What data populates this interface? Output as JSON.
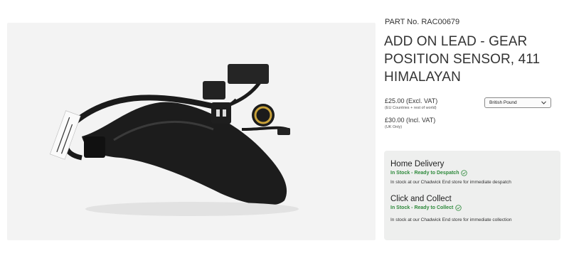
{
  "product": {
    "part_no": "PART No. RAC00679",
    "title": "ADD ON LEAD - GEAR POSITION SENSOR, 411 HIMALAYAN"
  },
  "pricing": {
    "excl": "£25.00 (Excl. VAT)",
    "excl_note": "(EU Countries + rest of world)",
    "incl": "£30.00 (Incl. VAT)",
    "incl_note": "(UK Only)",
    "currency": "British Pound"
  },
  "availability": {
    "home_delivery": {
      "title": "Home Delivery",
      "status": "In Stock - Ready to Despatch",
      "detail": "In stock at our Chadwick End store for immediate despatch"
    },
    "click_collect": {
      "title": "Click and Collect",
      "status": "In Stock - Ready to Collect",
      "detail": "In stock at our Chadwick End store for immediate collection"
    }
  },
  "colors": {
    "in_stock": "#2f8a3c",
    "box_bg": "#eeefee"
  },
  "icons": {
    "zoom": "zoom-in-icon",
    "check": "check-circle-icon",
    "select": "chevron-down-icon"
  }
}
